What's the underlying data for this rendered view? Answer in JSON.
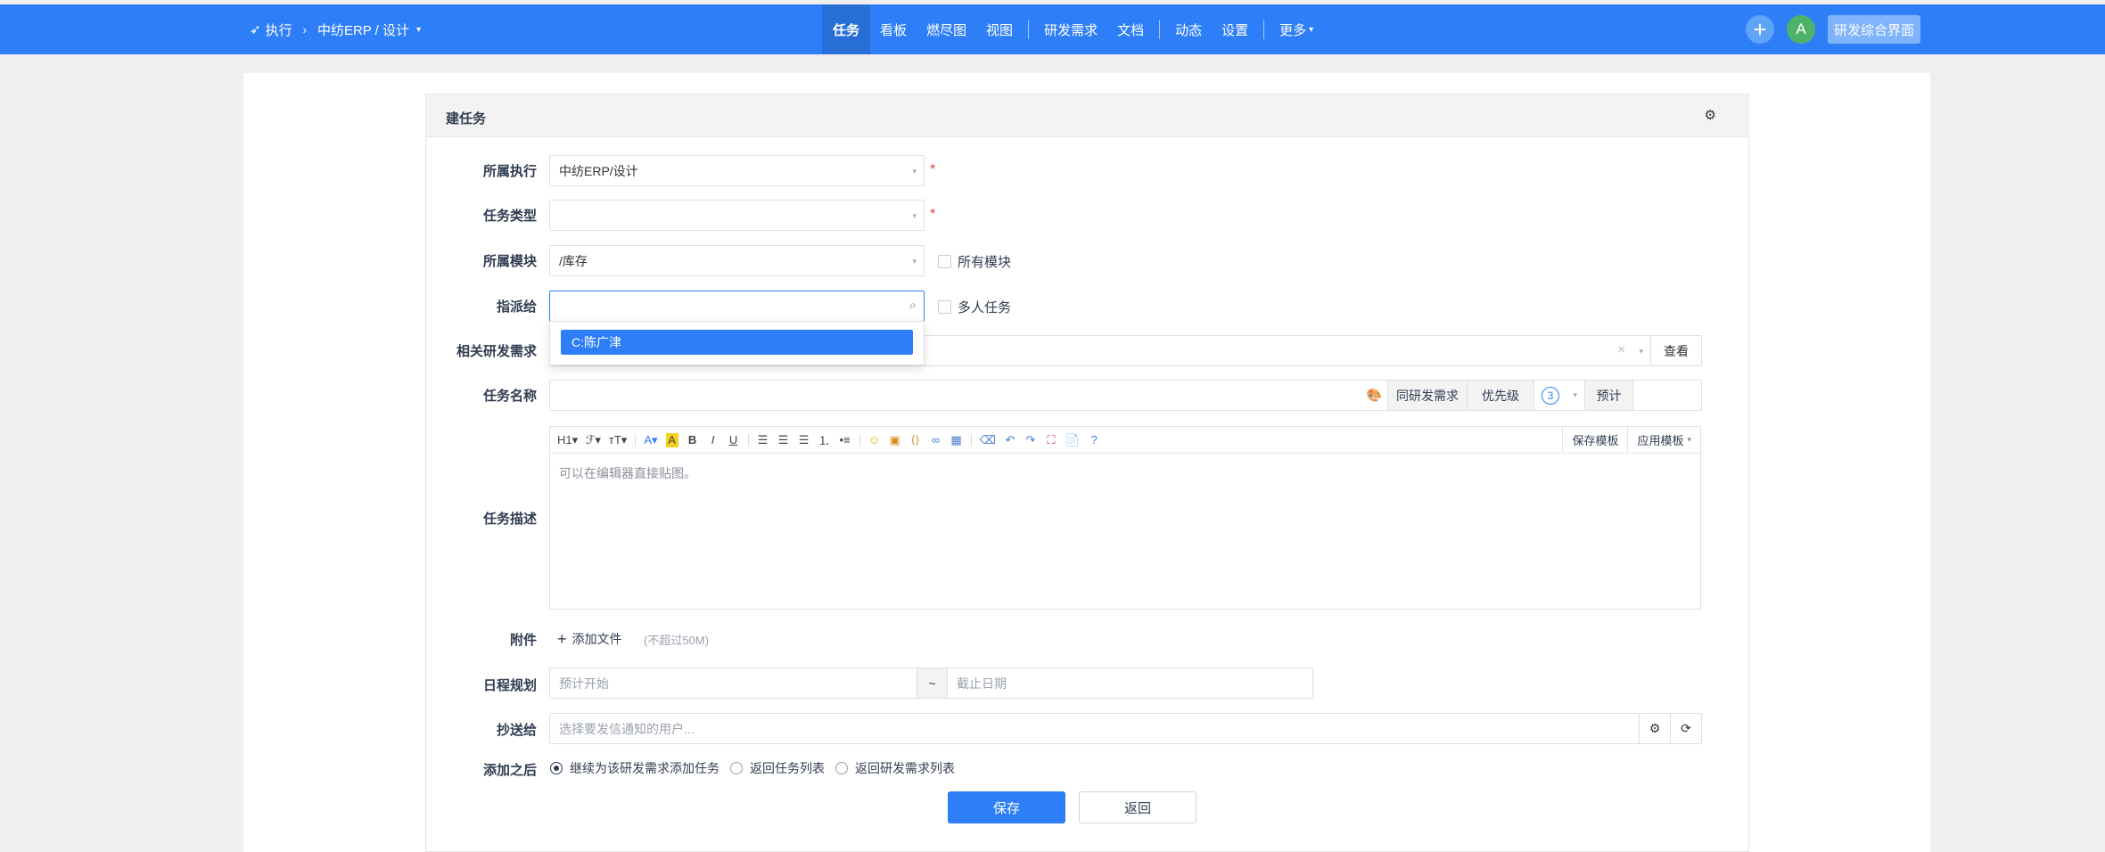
{
  "topbar": {
    "breadcrumb_root": "执行",
    "breadcrumb_current": "中纺ERP / 设计",
    "nav": [
      "任务",
      "看板",
      "燃尽图",
      "视图",
      "研发需求",
      "文档",
      "动态",
      "设置",
      "更多"
    ],
    "avatar_letter": "A",
    "app_button": "研发综合界面",
    "color": "#2e7ff7"
  },
  "card": {
    "title": "建任务"
  },
  "form": {
    "execution": {
      "label": "所属执行",
      "value": "中纺ERP/设计"
    },
    "type": {
      "label": "任务类型",
      "value": ""
    },
    "module": {
      "label": "所属模块",
      "value": "/库存",
      "checkbox": "所有模块"
    },
    "assign": {
      "label": "指派给",
      "value": "",
      "checkbox": "多人任务",
      "option": "C:陈广津"
    },
    "story": {
      "label": "相关研发需求",
      "view_button": "查看"
    },
    "name": {
      "label": "任务名称",
      "same_story": "同研发需求",
      "priority_label": "优先级",
      "priority_value": "3",
      "estimate_label": "预计"
    },
    "desc": {
      "label": "任务描述",
      "placeholder": "可以在编辑器直接贴图。",
      "save_template": "保存模板",
      "apply_template": "应用模板"
    },
    "attach": {
      "label": "附件",
      "add_file": "添加文件",
      "limit": "(不超过50M)"
    },
    "schedule": {
      "label": "日程规划",
      "start_placeholder": "预计开始",
      "tilde": "~",
      "end_placeholder": "截止日期"
    },
    "mailto": {
      "label": "抄送给",
      "placeholder": "选择要发信通知的用户..."
    },
    "after": {
      "label": "添加之后",
      "options": [
        "继续为该研发需求添加任务",
        "返回任务列表",
        "返回研发需求列表"
      ]
    },
    "save": "保存",
    "back": "返回"
  }
}
